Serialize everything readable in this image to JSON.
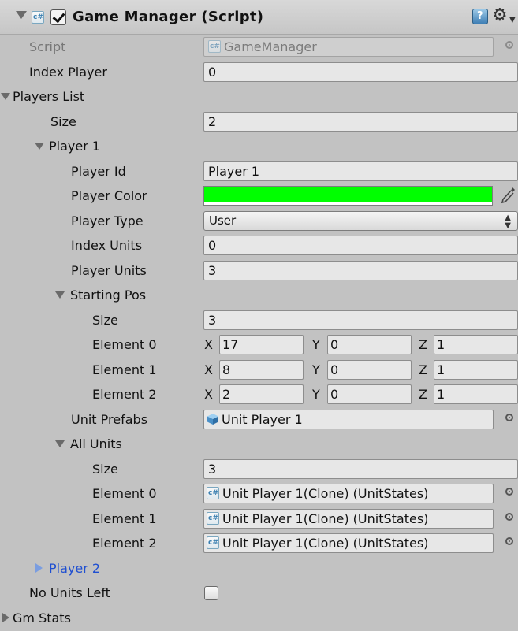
{
  "header": {
    "title": "Game Manager (Script)",
    "enabled": true,
    "help_icon": "help-icon",
    "settings_icon": "gear-icon"
  },
  "script": {
    "label": "Script",
    "value": "GameManager"
  },
  "index_player": {
    "label": "Index Player",
    "value": "0"
  },
  "players_list": {
    "label": "Players List",
    "size_label": "Size",
    "size": "2",
    "player1": {
      "label": "Player 1",
      "player_id": {
        "label": "Player Id",
        "value": "Player 1"
      },
      "player_color": {
        "label": "Player Color",
        "value": "#00ff00"
      },
      "player_type": {
        "label": "Player Type",
        "value": "User"
      },
      "index_units": {
        "label": "Index Units",
        "value": "0"
      },
      "player_units": {
        "label": "Player Units",
        "value": "3"
      },
      "starting_pos": {
        "label": "Starting Pos",
        "size_label": "Size",
        "size": "3",
        "axis_x": "X",
        "axis_y": "Y",
        "axis_z": "Z",
        "elements": [
          {
            "label": "Element 0",
            "x": "17",
            "y": "0",
            "z": "1"
          },
          {
            "label": "Element 1",
            "x": "8",
            "y": "0",
            "z": "1"
          },
          {
            "label": "Element 2",
            "x": "2",
            "y": "0",
            "z": "1"
          }
        ]
      },
      "unit_prefabs": {
        "label": "Unit Prefabs",
        "value": "Unit Player 1"
      },
      "all_units": {
        "label": "All Units",
        "size_label": "Size",
        "size": "3",
        "elements": [
          {
            "label": "Element 0",
            "value": "Unit Player 1(Clone) (UnitStates)"
          },
          {
            "label": "Element 1",
            "value": "Unit Player 1(Clone) (UnitStates)"
          },
          {
            "label": "Element 2",
            "value": "Unit Player 1(Clone) (UnitStates)"
          }
        ]
      }
    },
    "player2": {
      "label": "Player 2"
    }
  },
  "no_units_left": {
    "label": "No Units Left",
    "checked": false
  },
  "gm_stats": {
    "label": "Gm Stats"
  },
  "colors": {
    "panel_bg": "#c2c2c2",
    "field_bg": "#e7e7e7",
    "player_color": "#00ff00",
    "link_blue": "#1f4fd1"
  }
}
